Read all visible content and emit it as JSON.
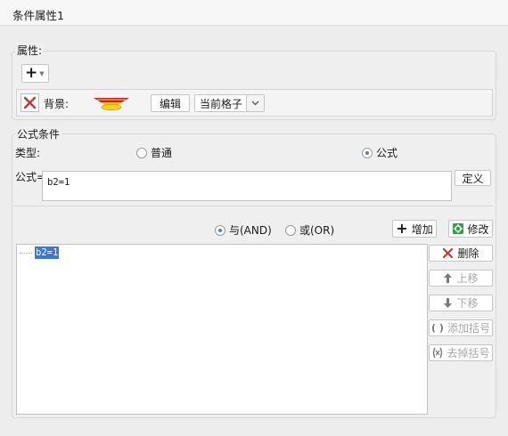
{
  "window": {
    "title": "条件属性1"
  },
  "attributes": {
    "legend": "属性:",
    "add_symbol": "+",
    "background_label": "背景:",
    "edit_button": "编辑",
    "scope_select": "当前格子"
  },
  "formula_condition": {
    "legend": "公式条件",
    "type_label": "类型:",
    "type_options": [
      "普通",
      "公式"
    ],
    "selected_type": "公式",
    "formula_label": "公式=",
    "formula_value": "b2=1",
    "define_button": "定义",
    "logic_options": [
      "与(AND)",
      "或(OR)"
    ],
    "selected_logic": "与(AND)",
    "add_button": "增加",
    "modify_button": "修改",
    "condition_list": [
      "b2=1"
    ],
    "delete_button": "删除",
    "move_up_button": "上移",
    "move_down_button": "下移",
    "add_bracket_button": "添加括号",
    "remove_bracket_button": "去掉括号"
  },
  "colors": {
    "accent": "#4a7fc9",
    "delete_red": "#d0312d",
    "selection": "#3a78d4",
    "icon_gray": "#7a7a7a"
  }
}
